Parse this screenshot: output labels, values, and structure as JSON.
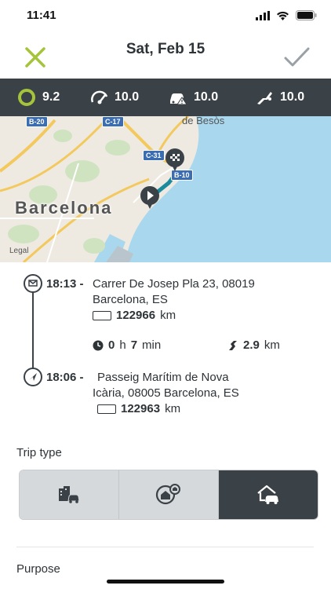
{
  "status_bar": {
    "time": "11:41"
  },
  "header": {
    "title": "Sat, Feb 15"
  },
  "scores": [
    {
      "icon": "score-ring-icon",
      "value": "9.2"
    },
    {
      "icon": "speedometer-icon",
      "value": "10.0"
    },
    {
      "icon": "car-warning-icon",
      "value": "10.0"
    },
    {
      "icon": "braking-icon",
      "value": "10.0"
    }
  ],
  "map": {
    "city": "Barcelona",
    "district": "de Besòs",
    "legal": "Legal",
    "roads": [
      "B-20",
      "C-17",
      "C-31",
      "B-10"
    ]
  },
  "trip": {
    "end": {
      "time": "18:13 -",
      "address_line1": "Carrer De Josep Pla 23, 08019",
      "address_line2": "Barcelona, ES",
      "odometer": "122966",
      "unit": "km"
    },
    "duration": {
      "hours": "0",
      "h_label": "h",
      "minutes": "7",
      "m_label": "min"
    },
    "distance": {
      "value": "2.9",
      "unit": "km"
    },
    "start": {
      "time": "18:06 -",
      "address_line1": "Passeig Marítim de Nova",
      "address_line2": "Icària, 08005 Barcelona, ES",
      "odometer": "122963",
      "unit": "km"
    }
  },
  "trip_type": {
    "label": "Trip type",
    "options": [
      "business-icon",
      "home-work-icon",
      "private-icon"
    ],
    "selected_index": 2
  },
  "purpose": {
    "label": "Purpose"
  },
  "colors": {
    "accent_green": "#a5c43a",
    "dark": "#3a4147",
    "water": "#a9d8ee"
  }
}
